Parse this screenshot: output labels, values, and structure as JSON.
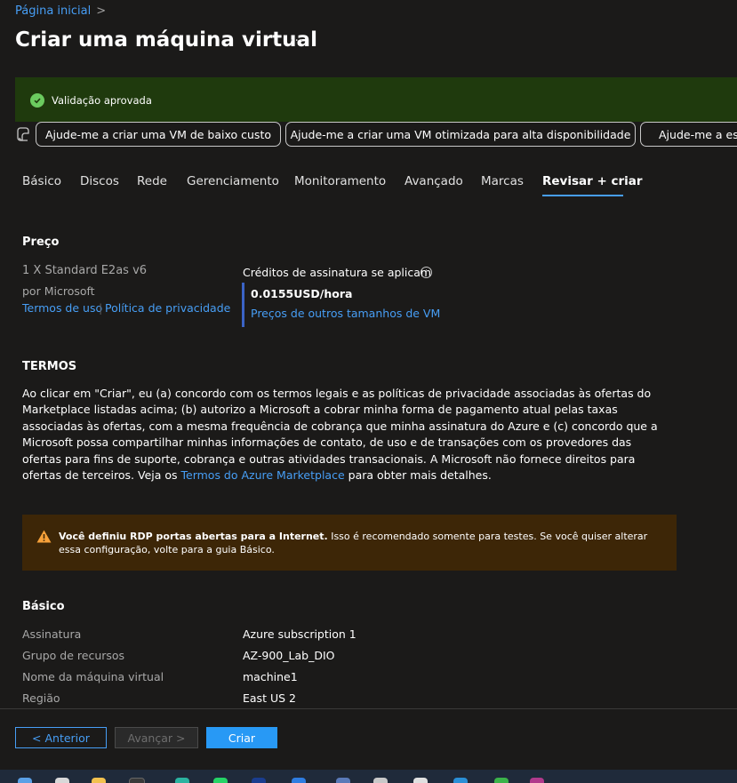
{
  "breadcrumb": {
    "home": "Página inicial",
    "separator": ">"
  },
  "title": "Criar uma máquina virtual",
  "more": "···",
  "validation": {
    "text": "Validação aprovada"
  },
  "copilot_prompts": [
    "Ajude-me a criar uma VM de baixo custo",
    "Ajude-me a criar uma VM otimizada para alta disponibilidade",
    "Ajude-me a esc"
  ],
  "tabs": [
    "Básico",
    "Discos",
    "Rede",
    "Gerenciamento",
    "Monitoramento",
    "Avançado",
    "Marcas",
    "Revisar + criar"
  ],
  "price": {
    "heading": "Preço",
    "product": "1 X Standard E2as v6",
    "publisher": "por Microsoft",
    "terms_link": "Termos de uso",
    "privacy_link": "Política de privacidade",
    "credits": "Créditos de assinatura se aplicam",
    "info": "i",
    "rate": "0.0155USD/hora",
    "other_sizes_link": "Preços de outros tamanhos de VM"
  },
  "terms": {
    "heading": "TERMOS",
    "text_before": "Ao clicar em \"Criar\", eu (a) concordo com os termos legais e as políticas de privacidade associadas às ofertas do Marketplace listadas acima; (b) autorizo a Microsoft a cobrar minha forma de pagamento atual pelas taxas associadas às ofertas, com a mesma frequência de cobrança que minha assinatura do Azure e (c) concordo que a Microsoft possa compartilhar minhas informações de contato, de uso e de transações com os provedores das ofertas para fins de suporte, cobrança e outras atividades transacionais. A Microsoft não fornece direitos para ofertas de terceiros. Veja os ",
    "link": "Termos do Azure Marketplace",
    "text_after": " para obter mais detalhes."
  },
  "warning": {
    "bold": "Você definiu RDP portas abertas para a Internet.",
    "text": " Isso é recomendado somente para testes.  Se você quiser alterar essa configuração, volte para a guia Básico."
  },
  "basics": {
    "heading": "Básico",
    "rows": [
      {
        "label": "Assinatura",
        "value": "Azure subscription 1"
      },
      {
        "label": "Grupo de recursos",
        "value": "AZ-900_Lab_DIO"
      },
      {
        "label": "Nome da máquina virtual",
        "value": "machine1"
      },
      {
        "label": "Região",
        "value": "East US 2"
      }
    ]
  },
  "footer": {
    "previous": "< Anterior",
    "next": "Avançar >",
    "create": "Criar"
  },
  "colors": {
    "accent": "#479ef5",
    "validation_bg": "#1f3a0d",
    "warning_bg": "#3d2607",
    "primary_button": "#2899f5"
  }
}
